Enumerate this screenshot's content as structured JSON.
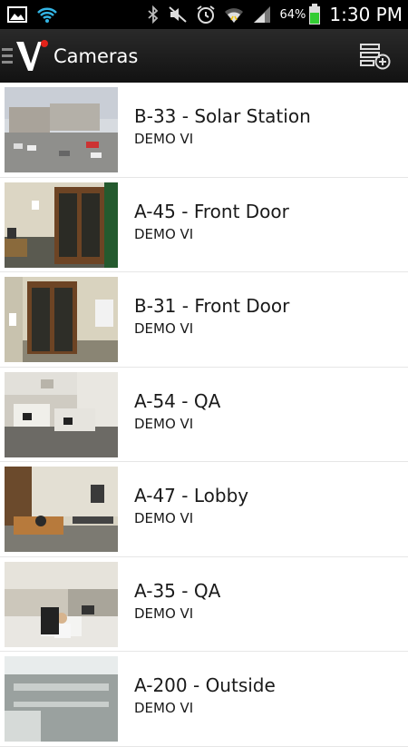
{
  "status_bar": {
    "battery_percent": "64%",
    "time": "1:30 PM"
  },
  "action_bar": {
    "title": "Cameras"
  },
  "cameras": [
    {
      "name": "B-33 - Solar Station",
      "site": "DEMO VI"
    },
    {
      "name": "A-45 - Front Door",
      "site": "DEMO VI"
    },
    {
      "name": "B-31 - Front Door",
      "site": "DEMO VI"
    },
    {
      "name": "A-54 - QA",
      "site": "DEMO VI"
    },
    {
      "name": "A-47 - Lobby",
      "site": "DEMO VI"
    },
    {
      "name": "A-35 - QA",
      "site": "DEMO VI"
    },
    {
      "name": "A-200 - Outside",
      "site": "DEMO VI"
    }
  ],
  "colors": {
    "logo_red": "#e2231a",
    "status_green": "#33cc33",
    "actionbar": "#1c1c1c"
  }
}
